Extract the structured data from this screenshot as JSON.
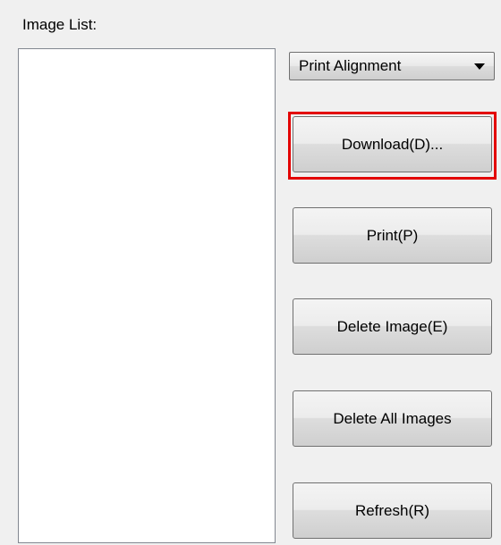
{
  "image_list": {
    "label": "Image List:",
    "items": []
  },
  "mode_select": {
    "selected": "Print Alignment"
  },
  "buttons": {
    "download": "Download(D)...",
    "print": "Print(P)",
    "delete_image": "Delete Image(E)",
    "delete_all": "Delete All Images",
    "refresh": "Refresh(R)"
  },
  "highlight_color": "#e30000"
}
